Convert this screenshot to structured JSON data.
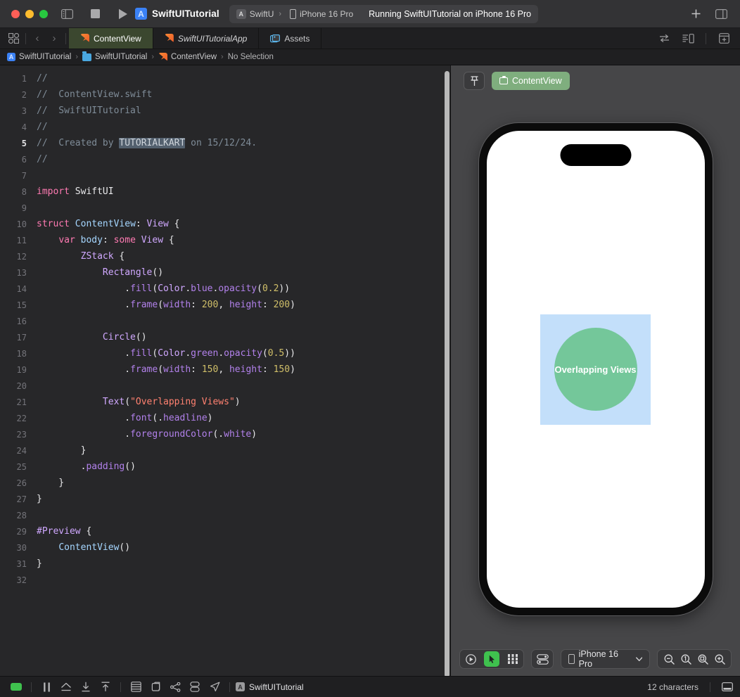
{
  "titlebar": {
    "project_name": "SwiftUITutorial",
    "project_icon": "A",
    "scheme_name": "SwiftU",
    "scheme_icon": "A",
    "scheme_chevron": "›",
    "destination": "iPhone 16 Pro",
    "status": "Running SwiftUITutorial on iPhone 16 Pro",
    "stop_button": "stop-button",
    "run_button": "run-button",
    "sidebar_toggle": "toggle-navigator",
    "add_button": "+",
    "inspector_toggle": "toggle-inspector"
  },
  "tabbar": {
    "tabs": [
      {
        "label": "ContentView",
        "icon": "swift-file-icon",
        "active": true,
        "italic": false
      },
      {
        "label": "SwiftUITutorialApp",
        "icon": "swift-file-icon",
        "active": false,
        "italic": true
      },
      {
        "label": "Assets",
        "icon": "assets-icon",
        "active": false,
        "italic": false
      }
    ],
    "back_chevron": "‹",
    "forward_chevron": "›"
  },
  "breadcrumb": {
    "items": [
      {
        "label": "SwiftUITutorial",
        "icon": "project-icon"
      },
      {
        "label": "SwiftUITutorial",
        "icon": "folder-icon"
      },
      {
        "label": "ContentView",
        "icon": "swift-file-icon"
      },
      {
        "label": "No Selection",
        "icon": "none"
      }
    ],
    "separator": "›"
  },
  "editor": {
    "selection_text": "TUTORIALKART",
    "current_line": 5,
    "total_lines": 32,
    "lines": [
      {
        "n": 1,
        "tokens": [
          {
            "t": "//",
            "c": "cm"
          }
        ]
      },
      {
        "n": 2,
        "tokens": [
          {
            "t": "//  ContentView.swift",
            "c": "cm"
          }
        ]
      },
      {
        "n": 3,
        "tokens": [
          {
            "t": "//  SwiftUITutorial",
            "c": "cm"
          }
        ]
      },
      {
        "n": 4,
        "tokens": [
          {
            "t": "//",
            "c": "cm"
          }
        ]
      },
      {
        "n": 5,
        "tokens": [
          {
            "t": "//  Created by ",
            "c": "cm"
          },
          {
            "t": "TUTORIALKART",
            "c": "sel"
          },
          {
            "t": " on 15/12/24.",
            "c": "cm"
          }
        ]
      },
      {
        "n": 6,
        "tokens": [
          {
            "t": "//",
            "c": "cm"
          }
        ]
      },
      {
        "n": 7,
        "tokens": []
      },
      {
        "n": 8,
        "tokens": [
          {
            "t": "import",
            "c": "kw"
          },
          {
            "t": " ",
            "c": "code"
          },
          {
            "t": "SwiftUI",
            "c": "code"
          }
        ]
      },
      {
        "n": 9,
        "tokens": []
      },
      {
        "n": 10,
        "tokens": [
          {
            "t": "struct",
            "c": "kw"
          },
          {
            "t": " ",
            "c": "code"
          },
          {
            "t": "ContentView",
            "c": "fn"
          },
          {
            "t": ": ",
            "c": "code"
          },
          {
            "t": "View",
            "c": "ty"
          },
          {
            "t": " {",
            "c": "code"
          }
        ]
      },
      {
        "n": 11,
        "tokens": [
          {
            "t": "    ",
            "c": "code"
          },
          {
            "t": "var",
            "c": "kw"
          },
          {
            "t": " ",
            "c": "code"
          },
          {
            "t": "body",
            "c": "fn"
          },
          {
            "t": ": ",
            "c": "code"
          },
          {
            "t": "some",
            "c": "kw"
          },
          {
            "t": " ",
            "c": "code"
          },
          {
            "t": "View",
            "c": "ty"
          },
          {
            "t": " {",
            "c": "code"
          }
        ]
      },
      {
        "n": 12,
        "tokens": [
          {
            "t": "        ",
            "c": "code"
          },
          {
            "t": "ZStack",
            "c": "ty"
          },
          {
            "t": " {",
            "c": "code"
          }
        ]
      },
      {
        "n": 13,
        "tokens": [
          {
            "t": "            ",
            "c": "code"
          },
          {
            "t": "Rectangle",
            "c": "ty"
          },
          {
            "t": "()",
            "c": "code"
          }
        ]
      },
      {
        "n": 14,
        "tokens": [
          {
            "t": "                .",
            "c": "code"
          },
          {
            "t": "fill",
            "c": "mtd"
          },
          {
            "t": "(",
            "c": "code"
          },
          {
            "t": "Color",
            "c": "ty"
          },
          {
            "t": ".",
            "c": "code"
          },
          {
            "t": "blue",
            "c": "mtd"
          },
          {
            "t": ".",
            "c": "code"
          },
          {
            "t": "opacity",
            "c": "mtd"
          },
          {
            "t": "(",
            "c": "code"
          },
          {
            "t": "0.2",
            "c": "num"
          },
          {
            "t": "))",
            "c": "code"
          }
        ]
      },
      {
        "n": 15,
        "tokens": [
          {
            "t": "                .",
            "c": "code"
          },
          {
            "t": "frame",
            "c": "mtd"
          },
          {
            "t": "(",
            "c": "code"
          },
          {
            "t": "width",
            "c": "mtd"
          },
          {
            "t": ": ",
            "c": "code"
          },
          {
            "t": "200",
            "c": "num"
          },
          {
            "t": ", ",
            "c": "code"
          },
          {
            "t": "height",
            "c": "mtd"
          },
          {
            "t": ": ",
            "c": "code"
          },
          {
            "t": "200",
            "c": "num"
          },
          {
            "t": ")",
            "c": "code"
          }
        ]
      },
      {
        "n": 16,
        "tokens": []
      },
      {
        "n": 17,
        "tokens": [
          {
            "t": "            ",
            "c": "code"
          },
          {
            "t": "Circle",
            "c": "ty"
          },
          {
            "t": "()",
            "c": "code"
          }
        ]
      },
      {
        "n": 18,
        "tokens": [
          {
            "t": "                .",
            "c": "code"
          },
          {
            "t": "fill",
            "c": "mtd"
          },
          {
            "t": "(",
            "c": "code"
          },
          {
            "t": "Color",
            "c": "ty"
          },
          {
            "t": ".",
            "c": "code"
          },
          {
            "t": "green",
            "c": "mtd"
          },
          {
            "t": ".",
            "c": "code"
          },
          {
            "t": "opacity",
            "c": "mtd"
          },
          {
            "t": "(",
            "c": "code"
          },
          {
            "t": "0.5",
            "c": "num"
          },
          {
            "t": "))",
            "c": "code"
          }
        ]
      },
      {
        "n": 19,
        "tokens": [
          {
            "t": "                .",
            "c": "code"
          },
          {
            "t": "frame",
            "c": "mtd"
          },
          {
            "t": "(",
            "c": "code"
          },
          {
            "t": "width",
            "c": "mtd"
          },
          {
            "t": ": ",
            "c": "code"
          },
          {
            "t": "150",
            "c": "num"
          },
          {
            "t": ", ",
            "c": "code"
          },
          {
            "t": "height",
            "c": "mtd"
          },
          {
            "t": ": ",
            "c": "code"
          },
          {
            "t": "150",
            "c": "num"
          },
          {
            "t": ")",
            "c": "code"
          }
        ]
      },
      {
        "n": 20,
        "tokens": []
      },
      {
        "n": 21,
        "tokens": [
          {
            "t": "            ",
            "c": "code"
          },
          {
            "t": "Text",
            "c": "ty"
          },
          {
            "t": "(",
            "c": "code"
          },
          {
            "t": "\"Overlapping Views\"",
            "c": "str"
          },
          {
            "t": ")",
            "c": "code"
          }
        ]
      },
      {
        "n": 22,
        "tokens": [
          {
            "t": "                .",
            "c": "code"
          },
          {
            "t": "font",
            "c": "mtd"
          },
          {
            "t": "(.",
            "c": "code"
          },
          {
            "t": "headline",
            "c": "mtd"
          },
          {
            "t": ")",
            "c": "code"
          }
        ]
      },
      {
        "n": 23,
        "tokens": [
          {
            "t": "                .",
            "c": "code"
          },
          {
            "t": "foregroundColor",
            "c": "mtd"
          },
          {
            "t": "(.",
            "c": "code"
          },
          {
            "t": "white",
            "c": "mtd"
          },
          {
            "t": ")",
            "c": "code"
          }
        ]
      },
      {
        "n": 24,
        "tokens": [
          {
            "t": "        }",
            "c": "code"
          }
        ]
      },
      {
        "n": 25,
        "tokens": [
          {
            "t": "        .",
            "c": "code"
          },
          {
            "t": "padding",
            "c": "mtd"
          },
          {
            "t": "()",
            "c": "code"
          }
        ]
      },
      {
        "n": 26,
        "tokens": [
          {
            "t": "    }",
            "c": "code"
          }
        ]
      },
      {
        "n": 27,
        "tokens": [
          {
            "t": "}",
            "c": "code"
          }
        ]
      },
      {
        "n": 28,
        "tokens": []
      },
      {
        "n": 29,
        "tokens": [
          {
            "t": "#Preview",
            "c": "ty"
          },
          {
            "t": " {",
            "c": "code"
          }
        ]
      },
      {
        "n": 30,
        "tokens": [
          {
            "t": "    ",
            "c": "code"
          },
          {
            "t": "ContentView",
            "c": "fn"
          },
          {
            "t": "()",
            "c": "code"
          }
        ]
      },
      {
        "n": 31,
        "tokens": [
          {
            "t": "}",
            "c": "code"
          }
        ]
      },
      {
        "n": 32,
        "tokens": []
      }
    ]
  },
  "preview": {
    "pin_button": "pin-preview",
    "chip_label": "ContentView",
    "chip_color": "#7fae7e",
    "device_name": "iPhone 16 Pro",
    "device_chevron": "∨",
    "rendered": {
      "rect_color": "#c3dffa",
      "circle_color": "#74c79a",
      "text": "Overlapping Views",
      "text_color": "#ffffff"
    },
    "controls": {
      "play_button": "live-preview-play",
      "select_button": "selectable-mode",
      "variants_button": "preview-variants",
      "device_settings_button": "device-settings",
      "zoom_out": "zoom-out",
      "zoom_actual": "zoom-100",
      "zoom_fit": "zoom-to-fit",
      "zoom_in": "zoom-in"
    }
  },
  "statusbar": {
    "icons": [
      "activity-indicator",
      "pause-button",
      "home-button",
      "download-button",
      "upload-button",
      "memory-button",
      "layers-button",
      "graph-button",
      "database-button",
      "location-button"
    ],
    "project_label": "SwiftUITutorial",
    "project_icon": "A",
    "char_count": "12 characters",
    "console_toggle": "toggle-console"
  }
}
